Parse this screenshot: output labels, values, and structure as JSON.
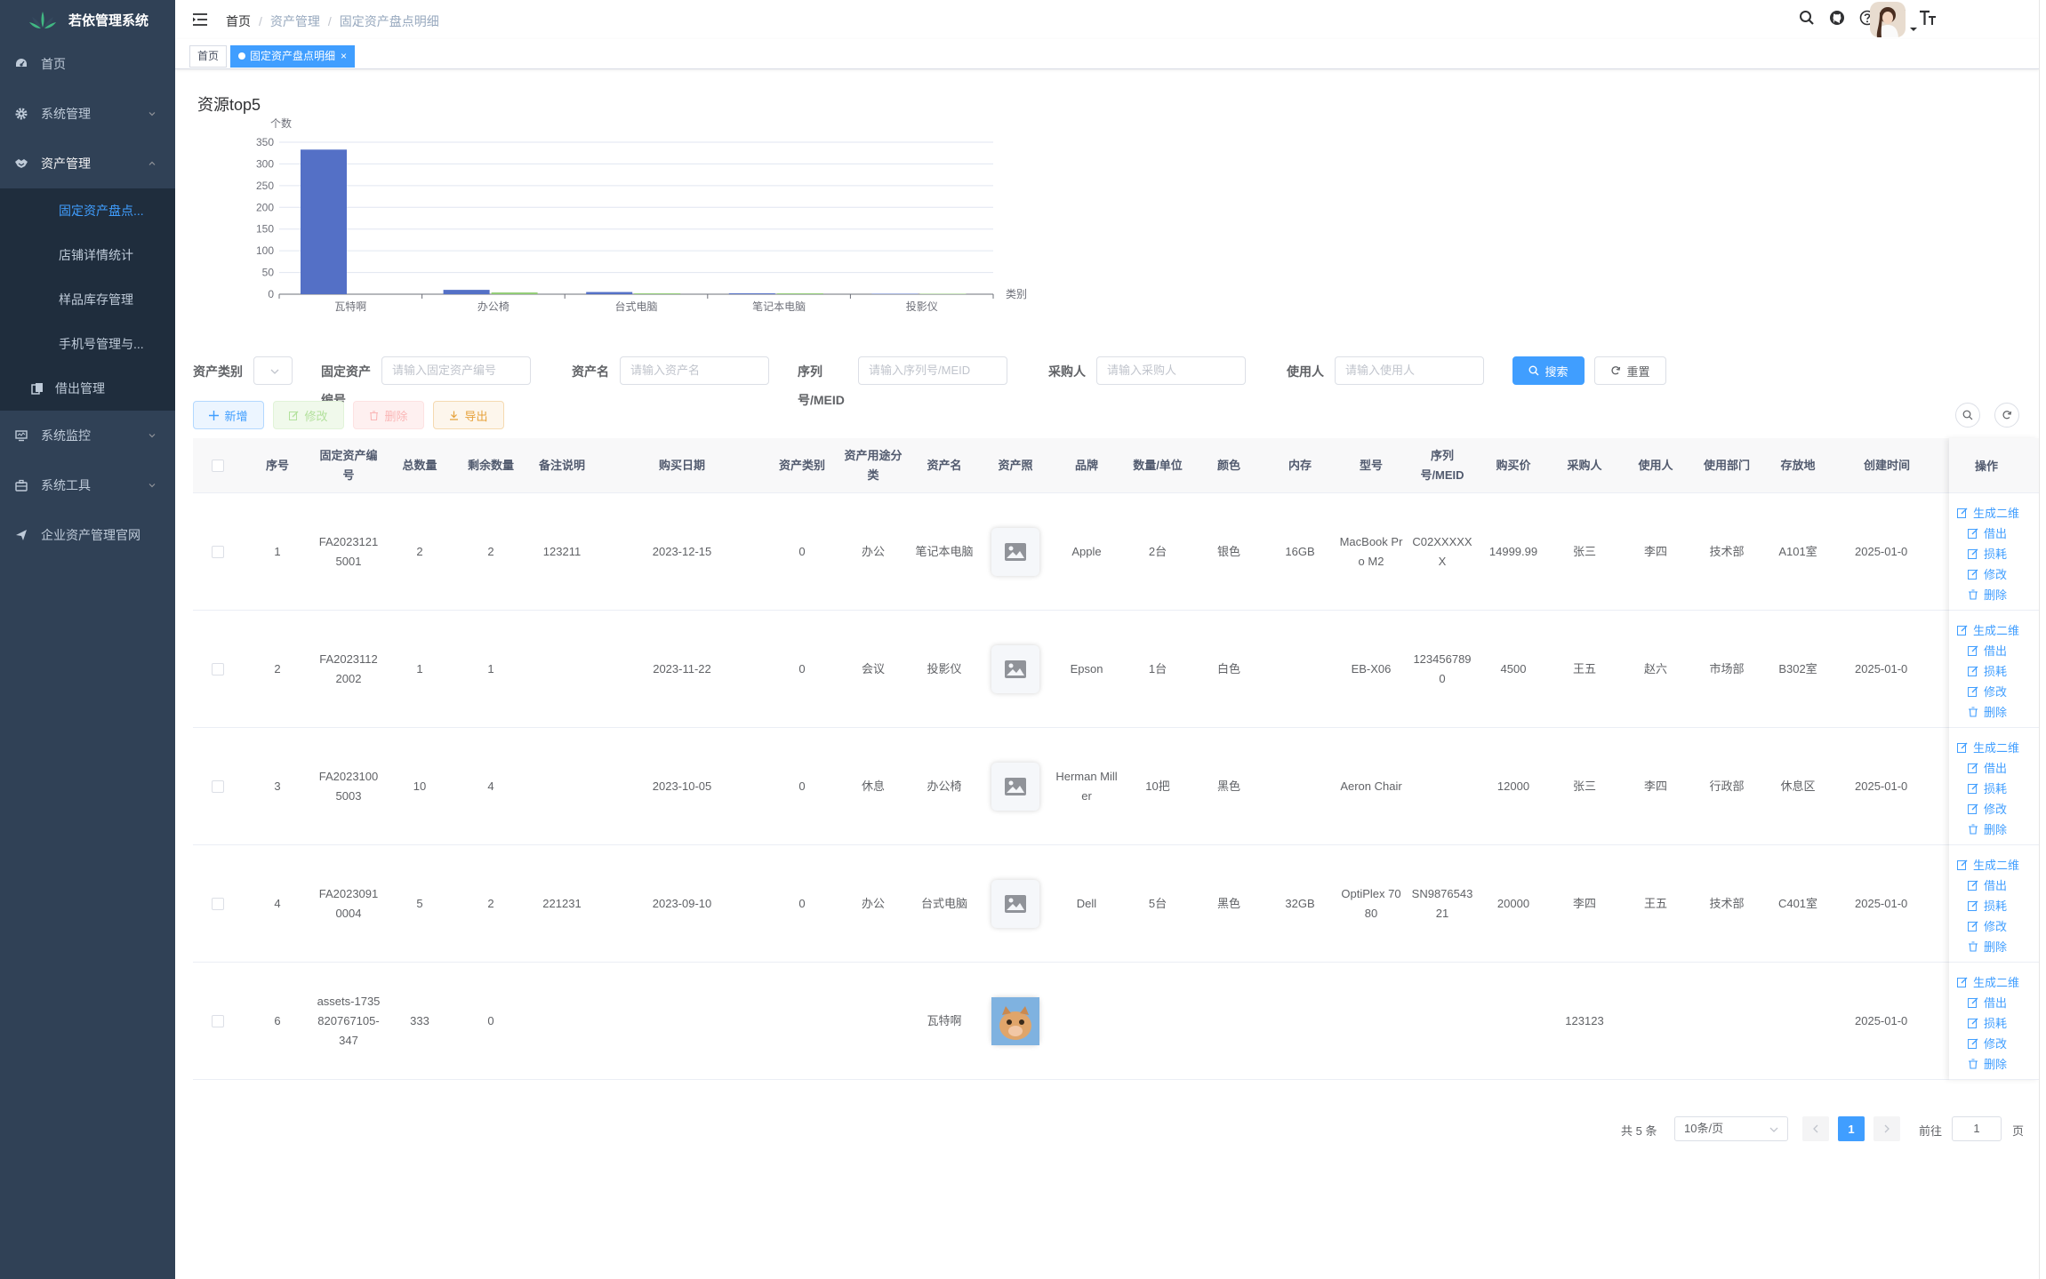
{
  "app": {
    "logo_text": "若依管理系统"
  },
  "sidebar": {
    "home": "首页",
    "system": "系统管理",
    "assets": "资产管理",
    "assets_children": [
      "固定资产盘点...",
      "店铺详情统计",
      "样品库存管理",
      "手机号管理与..."
    ],
    "borrow": "借出管理",
    "monitor": "系统监控",
    "tools": "系统工具",
    "website": "企业资产管理官网"
  },
  "breadcrumb": [
    "首页",
    "资产管理",
    "固定资产盘点明细"
  ],
  "tags": {
    "home": "首页",
    "current": "固定资产盘点明细"
  },
  "chart_data": {
    "type": "bar",
    "title": "资源top5",
    "ylabel": "个数",
    "xlabel": "类别",
    "categories": [
      "瓦特啊",
      "办公椅",
      "台式电脑",
      "笔记本电脑",
      "投影仪"
    ],
    "series": [
      {
        "color": "#5470c6",
        "values": [
          333,
          10,
          5,
          2,
          1
        ]
      },
      {
        "color": "#91cc75",
        "values": [
          0,
          4,
          2,
          2,
          1
        ]
      }
    ],
    "ylim": [
      0,
      350
    ],
    "yticks": [
      "0",
      "50",
      "100",
      "150",
      "200",
      "250",
      "300",
      "350"
    ],
    "grid": true
  },
  "search": {
    "type_label": "资产类别",
    "code_label_1": "固定资产",
    "code_label_2": "编号",
    "code_placeholder": "请输入固定资产编号",
    "name_label": "资产名",
    "name_placeholder": "请输入资产名",
    "serial_label_1": "序列",
    "serial_label_2": "号/MEID",
    "serial_placeholder": "请输入序列号/MEID",
    "buyer_label": "采购人",
    "buyer_placeholder": "请输入采购人",
    "user_label": "使用人",
    "user_placeholder": "请输入使用人",
    "search_btn": "搜索",
    "reset_btn": "重置"
  },
  "toolbar": {
    "add": "新增",
    "edit": "修改",
    "delete": "删除",
    "export": "导出"
  },
  "table": {
    "headers": [
      "序号",
      "固定资产编号",
      "总数量",
      "剩余数量",
      "备注说明",
      "购买日期",
      "资产类别",
      "资产用途分类",
      "资产名",
      "资产照",
      "品牌",
      "数量/单位",
      "颜色",
      "内存",
      "型号",
      "序列号/MEID",
      "购买价",
      "采购人",
      "使用人",
      "使用部门",
      "存放地",
      "创建时间"
    ],
    "op_header": "操作",
    "rows": [
      [
        "1",
        "FA20231215001",
        "2",
        "2",
        "123211",
        "2023-12-15",
        "0",
        "办公",
        "笔记本电脑",
        "",
        "Apple",
        "2台",
        "银色",
        "16GB",
        "MacBook Pro M2",
        "C02XXXXXX",
        "14999.99",
        "张三",
        "李四",
        "技术部",
        "A101室",
        "2025-01-0"
      ],
      [
        "2",
        "FA20231122002",
        "1",
        "1",
        "",
        "2023-11-22",
        "0",
        "会议",
        "投影仪",
        "",
        "Epson",
        "1台",
        "白色",
        "",
        "EB-X06",
        "1234567890",
        "4500",
        "王五",
        "赵六",
        "市场部",
        "B302室",
        "2025-01-0"
      ],
      [
        "3",
        "FA20231005003",
        "10",
        "4",
        "",
        "2023-10-05",
        "0",
        "休息",
        "办公椅",
        "",
        "Herman Miller",
        "10把",
        "黑色",
        "",
        "Aeron Chair",
        "",
        "12000",
        "张三",
        "李四",
        "行政部",
        "休息区",
        "2025-01-0"
      ],
      [
        "4",
        "FA20230910004",
        "5",
        "2",
        "221231",
        "2023-09-10",
        "0",
        "办公",
        "台式电脑",
        "",
        "Dell",
        "5台",
        "黑色",
        "32GB",
        "OptiPlex 7080",
        "SN987654321",
        "20000",
        "李四",
        "王五",
        "技术部",
        "C401室",
        "2025-01-0"
      ],
      [
        "6",
        "assets-1735820767105-347",
        "333",
        "0",
        "",
        "",
        "",
        "",
        "瓦特啊",
        "",
        "",
        "",
        "",
        "",
        "",
        "",
        "",
        "123123",
        "",
        "",
        "",
        "2025-01-0"
      ]
    ],
    "ops": [
      "生成二维",
      "借出",
      "损耗",
      "修改",
      "删除"
    ]
  },
  "pagination": {
    "total": "共 5 条",
    "page_size": "10条/页",
    "current": "1",
    "goto_label": "前往",
    "goto_value": "1",
    "page_unit": "页"
  }
}
